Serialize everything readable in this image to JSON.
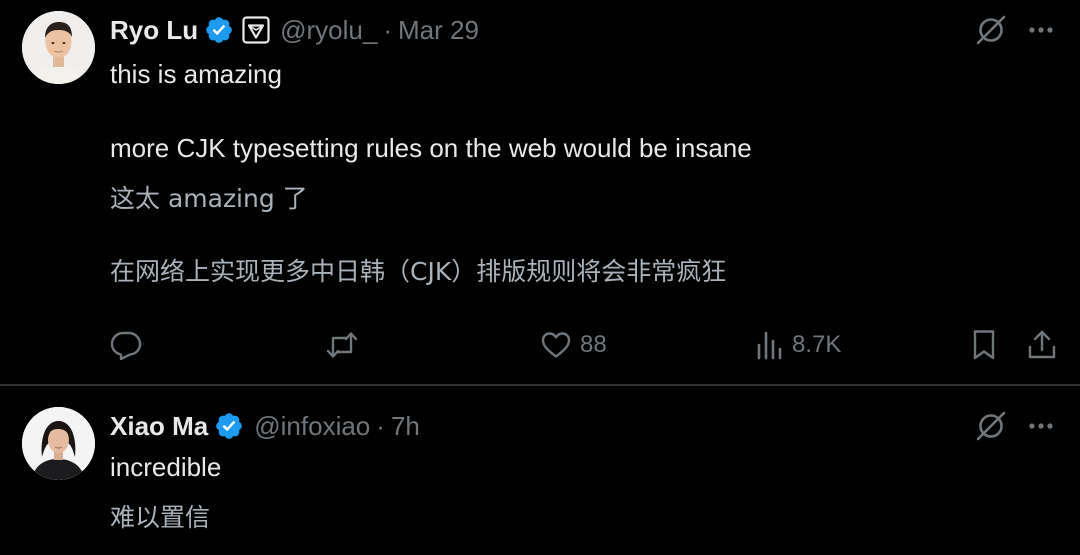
{
  "tweets": [
    {
      "author_name": "Ryo Lu",
      "handle": "@ryolu_",
      "separator": "·",
      "time": "Mar 29",
      "text_lines": [
        "this is amazing",
        "more CJK typesetting rules on the web would be insane"
      ],
      "translation_lines": [
        "这太 amazing 了",
        "在网络上实现更多中日韩（CJK）排版规则将会非常疯狂"
      ],
      "actions": {
        "reply_count": "",
        "repost_count": "",
        "like_count": "88",
        "views_count": "8.7K"
      }
    },
    {
      "author_name": "Xiao Ma",
      "handle": "@infoxiao",
      "separator": "·",
      "time": "7h",
      "text_lines": [
        "incredible"
      ],
      "translation_lines": [
        "难以置信"
      ]
    }
  ],
  "icons": {
    "verified": "verified-badge-icon",
    "affiliate": "cursor-logo-badge-icon",
    "grok": "grok-slash-icon",
    "more": "more-dots-icon",
    "reply": "reply-bubble-icon",
    "repost": "repost-arrows-icon",
    "like": "heart-icon",
    "views": "bar-chart-icon",
    "bookmark": "bookmark-icon",
    "share": "share-upload-icon"
  },
  "colors": {
    "background": "#000000",
    "primary_text": "#e7e9ea",
    "secondary_text": "#71767b",
    "verified_blue": "#1d9bf0",
    "divider": "#2f3336"
  }
}
